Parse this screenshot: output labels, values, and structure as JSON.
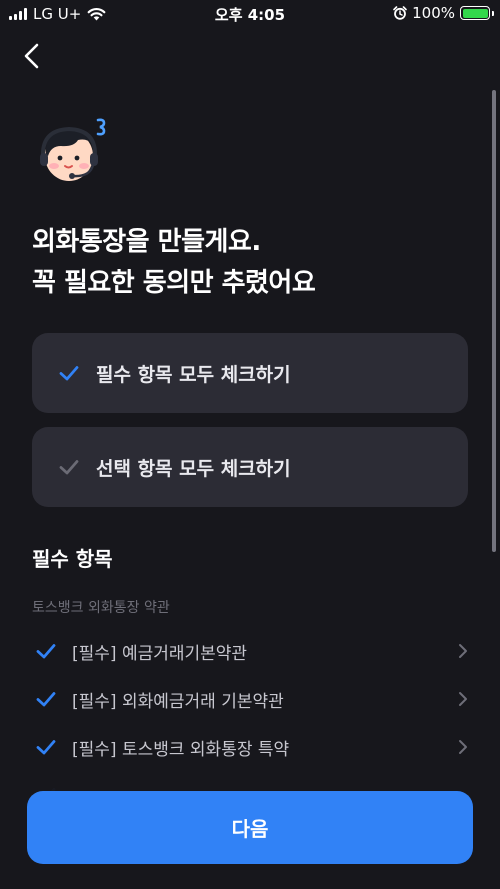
{
  "status_bar": {
    "carrier": "LG U+",
    "time": "오후 4:05",
    "battery": "100%",
    "battery_level": 1.0,
    "icons": [
      "signal-icon",
      "wifi-icon",
      "alarm-icon",
      "battery-charging-icon"
    ]
  },
  "nav": {
    "back_icon": "chevron-left-icon"
  },
  "headline": {
    "line1": "외화통장을 만들게요.",
    "line2": "꼭 필요한 동의만 추렸어요"
  },
  "agree_all": [
    {
      "label": "필수 항목 모두 체크하기",
      "checked": true
    },
    {
      "label": "선택 항목 모두 체크하기",
      "checked": false
    }
  ],
  "required_section": {
    "title": "필수 항목",
    "subtitle": "토스뱅크 외화통장 약관",
    "items": [
      {
        "label": "[필수] 예금거래기본약관",
        "checked": true
      },
      {
        "label": "[필수] 외화예금거래 기본약관",
        "checked": true
      },
      {
        "label": "[필수] 토스뱅크 외화통장 특약",
        "checked": true
      }
    ]
  },
  "colors": {
    "background": "#17171c",
    "card": "#2c2c35",
    "accent": "#3182f6",
    "check_inactive": "#6b6b75"
  },
  "cta": {
    "label": "다음"
  }
}
